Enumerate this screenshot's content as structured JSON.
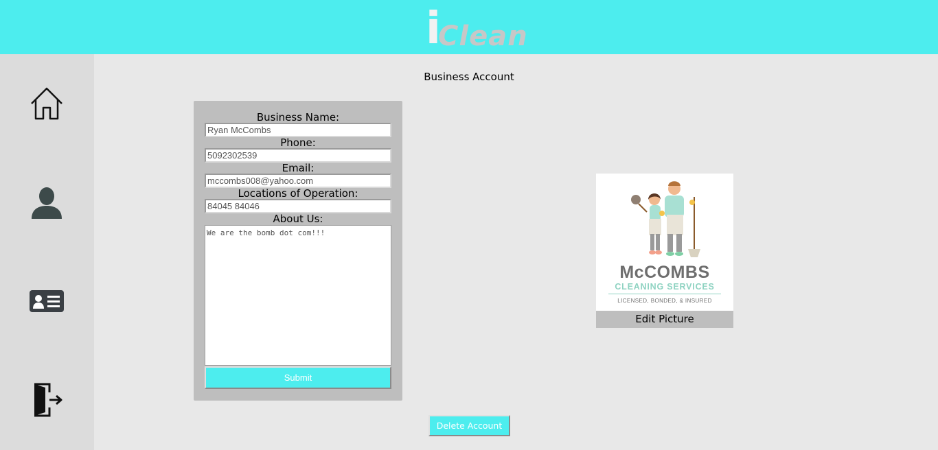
{
  "header": {
    "logo_i": "i",
    "logo_rest": "Clean"
  },
  "sidebar": {
    "items": [
      {
        "icon": "home-icon"
      },
      {
        "icon": "user-icon"
      },
      {
        "icon": "id-card-icon"
      },
      {
        "icon": "logout-door-icon"
      }
    ]
  },
  "page": {
    "title": "Business Account"
  },
  "form": {
    "business_name_label": "Business Name:",
    "business_name_value": "Ryan McCombs",
    "phone_label": "Phone:",
    "phone_value": "5092302539",
    "email_label": "Email:",
    "email_value": "mccombs008@yahoo.com",
    "locations_label": "Locations of Operation:",
    "locations_value": "84045 84046",
    "about_label": "About Us:",
    "about_value": "We are the bomb dot com!!!",
    "submit_label": "Submit"
  },
  "picture": {
    "brand_line1": "McCOMBS",
    "brand_line2": "CLEANING SERVICES",
    "brand_line3": "LICENSED, BONDED, & INSURED",
    "edit_label": "Edit Picture"
  },
  "actions": {
    "delete_label": "Delete Account"
  },
  "colors": {
    "accent": "#4dedee",
    "sidebar_bg": "#dcdcdc",
    "page_bg": "#e8e8e8",
    "panel_bg": "#bebebe"
  }
}
